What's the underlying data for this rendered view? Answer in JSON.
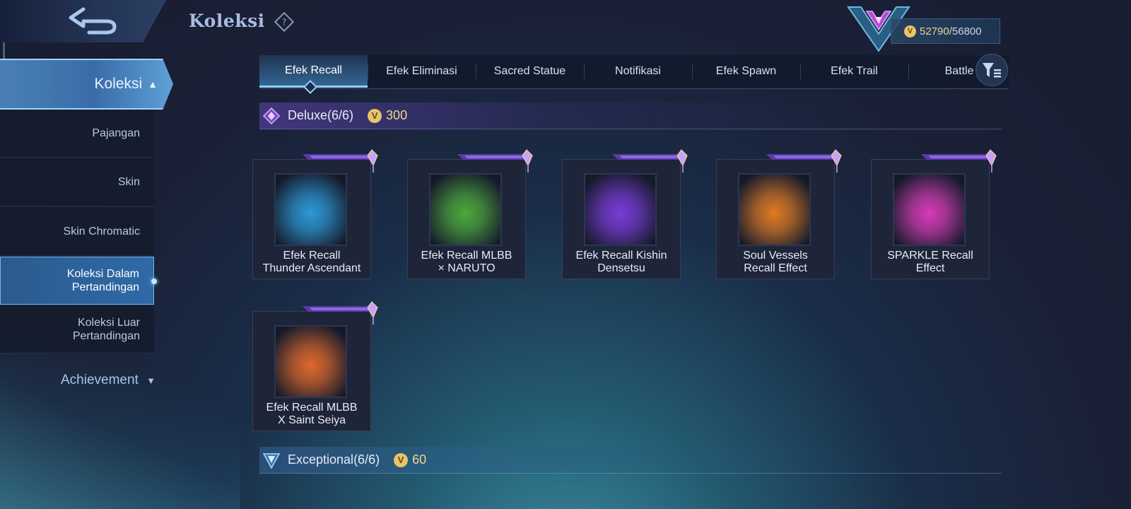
{
  "header": {
    "title": "Koleksi",
    "back_icon": "back-arrow-icon",
    "help_icon": "question-diamond-icon",
    "currency": {
      "current": "52790",
      "separator": "/",
      "max": "56800",
      "coin_symbol": "V"
    }
  },
  "sidebar": {
    "active_section": "Koleksi",
    "items": [
      {
        "label": "Pajangan",
        "selected": false
      },
      {
        "label": "Skin",
        "selected": false
      },
      {
        "label": "Skin Chromatic",
        "selected": false
      },
      {
        "label": "Koleksi Dalam Pertandingan",
        "selected": true
      },
      {
        "label": "Koleksi Luar Pertandingan",
        "selected": false
      }
    ],
    "achievement": "Achievement"
  },
  "tabs": [
    {
      "label": "Efek Recall",
      "active": true
    },
    {
      "label": "Efek Eliminasi",
      "active": false
    },
    {
      "label": "Sacred Statue",
      "active": false
    },
    {
      "label": "Notifikasi",
      "active": false
    },
    {
      "label": "Efek Spawn",
      "active": false
    },
    {
      "label": "Efek Trail",
      "active": false
    },
    {
      "label": "Battle I",
      "active": false
    }
  ],
  "sections": {
    "deluxe": {
      "name": "Deluxe",
      "count": "(6/6)",
      "price": "300"
    },
    "exceptional": {
      "name": "Exceptional",
      "count": "(6/6)",
      "price": "60"
    }
  },
  "cards": [
    {
      "line1": "Efek Recall",
      "line2": "Thunder Ascendant",
      "theme": "#2a9ad8"
    },
    {
      "line1": "Efek Recall MLBB",
      "line2": "× NARUTO",
      "theme": "#4caa3a"
    },
    {
      "line1": "Efek Recall Kishin",
      "line2": "Densetsu",
      "theme": "#7a3ad8"
    },
    {
      "line1": "Soul Vessels",
      "line2": "Recall Effect",
      "theme": "#e07a22"
    },
    {
      "line1": "SPARKLE Recall",
      "line2": "Effect",
      "theme": "#d83ab8"
    },
    {
      "line1": "Efek Recall MLBB",
      "line2": "X Saint Seiya",
      "theme": "#e0682a"
    }
  ],
  "colors": {
    "accent_blue": "#8fd0ff",
    "gold": "#f0d58c",
    "deluxe_purple": "#8a5ad8"
  }
}
